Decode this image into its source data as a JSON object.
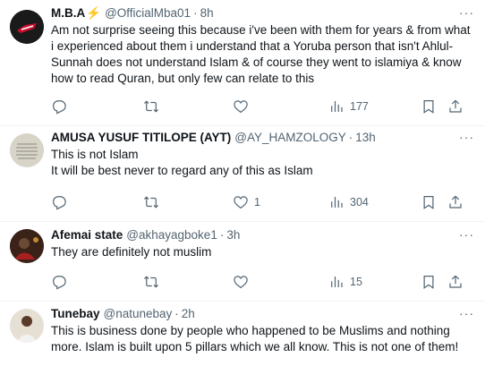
{
  "tweets": [
    {
      "name": "M.B.A",
      "badge": "⚡",
      "handle": "@OfficialMba01",
      "sep": "·",
      "time": "8h",
      "text": "Am not surprise seeing this because i've been with them for years & from what i experienced about them i understand that a Yoruba person that isn't Ahlul-Sunnah does not understand Islam & of course they went to islamiya & know how to read Quran, but only few can relate to this",
      "likes": "",
      "views": "177"
    },
    {
      "name": "AMUSA YUSUF TITILOPE (AYT)",
      "handle": "@AY_HAMZOLOGY",
      "sep": "·",
      "time": "13h",
      "text": "This is not Islam\nIt will be best never to regard any of this as Islam",
      "likes": "1",
      "views": "304"
    },
    {
      "name": "Afemai state",
      "handle": "@akhayagboke1",
      "sep": "·",
      "time": "3h",
      "text": "They are definitely not muslim",
      "likes": "",
      "views": "15"
    },
    {
      "name": "Tunebay",
      "handle": "@natunebay",
      "sep": "·",
      "time": "2h",
      "text": "This is business done by people who happened to be Muslims and nothing more. Islam is built upon 5 pillars which we all know. This is not one of them!"
    }
  ],
  "more_label": "···",
  "colors": {
    "text": "#0f1419",
    "muted": "#536471",
    "divider": "#eff3f4"
  },
  "icons": [
    "reply-icon",
    "retweet-icon",
    "like-icon",
    "views-icon",
    "bookmark-icon",
    "share-icon",
    "more-icon"
  ]
}
